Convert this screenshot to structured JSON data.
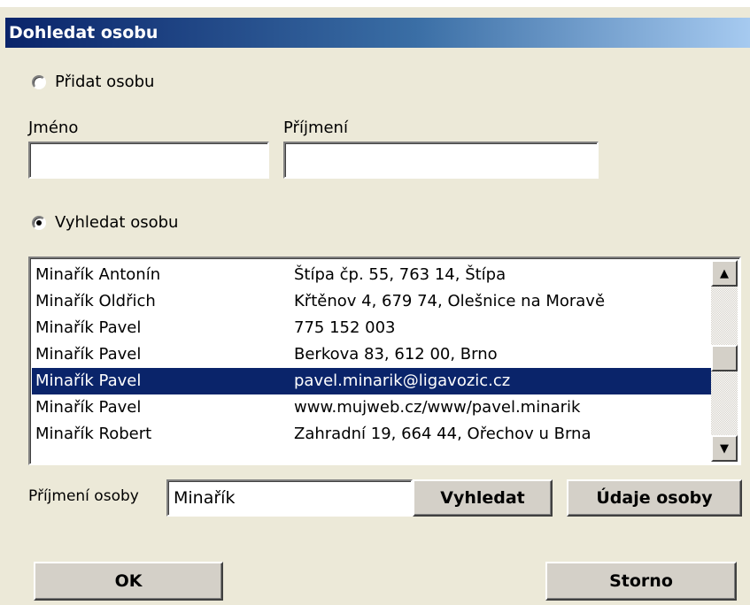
{
  "window": {
    "title": "Dohledat osobu"
  },
  "add_person": {
    "radio_label": "Přidat osobu",
    "checked": false,
    "first_name_label": "Jméno",
    "first_name_value": "",
    "last_name_label": "Příjmení",
    "last_name_value": ""
  },
  "search_person": {
    "radio_label": "Vyhledat osobu",
    "checked": true
  },
  "results": [
    {
      "name": "Minařík Antonín",
      "detail": "Štípa čp. 55, 763 14, Štípa",
      "selected": false
    },
    {
      "name": "Minařík Oldřich",
      "detail": "Křtěnov 4, 679 74, Olešnice na Moravě",
      "selected": false
    },
    {
      "name": "Minařík Pavel",
      "detail": "775 152 003",
      "selected": false
    },
    {
      "name": "Minařík Pavel",
      "detail": "Berkova 83, 612 00, Brno",
      "selected": false
    },
    {
      "name": "Minařík Pavel",
      "detail": "pavel.minarik@ligavozic.cz",
      "selected": true
    },
    {
      "name": "Minařík Pavel",
      "detail": "www.mujweb.cz/www/pavel.minarik",
      "selected": false
    },
    {
      "name": "Minařík Robert",
      "detail": "Zahradní 19, 664 44, Ořechov u Brna",
      "selected": false
    }
  ],
  "scrollbar": {
    "up_icon": "arrow-up-icon",
    "down_icon": "arrow-down-icon"
  },
  "search_bar": {
    "surname_label": "Příjmení osoby",
    "surname_value": "Minařík",
    "search_button": "Vyhledat",
    "details_button": "Údaje osoby"
  },
  "footer": {
    "ok_button": "OK",
    "cancel_button": "Storno"
  }
}
